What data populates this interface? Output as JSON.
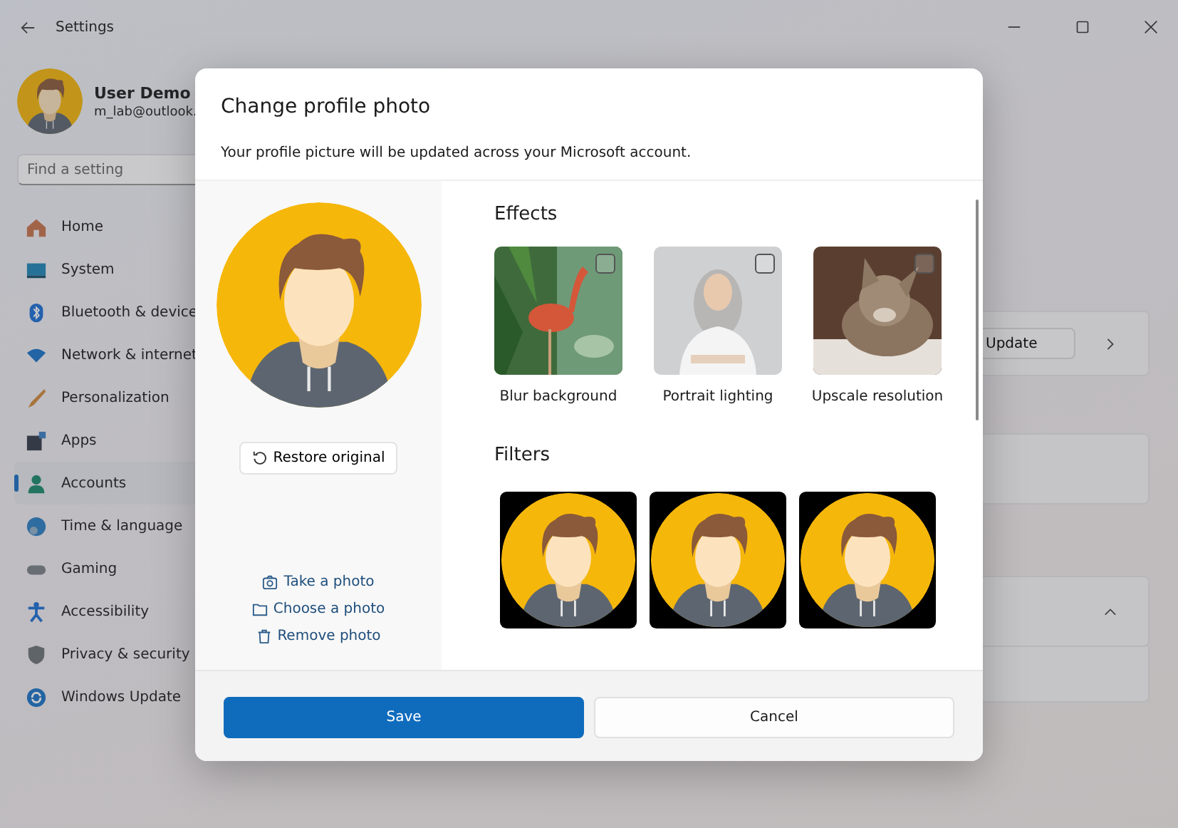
{
  "window": {
    "title": "Settings"
  },
  "user": {
    "name": "User Demo",
    "email": "m_lab@outlook."
  },
  "search": {
    "placeholder": "Find a setting"
  },
  "nav": [
    {
      "label": "Home",
      "selected": false
    },
    {
      "label": "System",
      "selected": false
    },
    {
      "label": "Bluetooth & device",
      "selected": false
    },
    {
      "label": "Network & internet",
      "selected": false
    },
    {
      "label": "Personalization",
      "selected": false
    },
    {
      "label": "Apps",
      "selected": false
    },
    {
      "label": "Accounts",
      "selected": true
    },
    {
      "label": "Time & language",
      "selected": false
    },
    {
      "label": "Gaming",
      "selected": false
    },
    {
      "label": "Accessibility",
      "selected": false
    },
    {
      "label": "Privacy & security",
      "selected": false
    },
    {
      "label": "Windows Update",
      "selected": false
    }
  ],
  "background": {
    "update_button": "Update"
  },
  "dialog": {
    "title": "Change profile photo",
    "subtitle": "Your profile picture will be updated across your Microsoft account.",
    "restore_button": "Restore original",
    "links": [
      "Take a photo",
      "Choose a photo",
      "Remove photo"
    ],
    "effects_heading": "Effects",
    "effects": [
      {
        "label": "Blur background",
        "checked": false
      },
      {
        "label": "Portrait lighting",
        "checked": false
      },
      {
        "label": "Upscale resolution",
        "checked": false
      }
    ],
    "filters_heading": "Filters",
    "filters": [
      {
        "kind": "avatar"
      },
      {
        "kind": "avatar"
      },
      {
        "kind": "avatar"
      }
    ],
    "save_button": "Save",
    "cancel_button": "Cancel"
  }
}
